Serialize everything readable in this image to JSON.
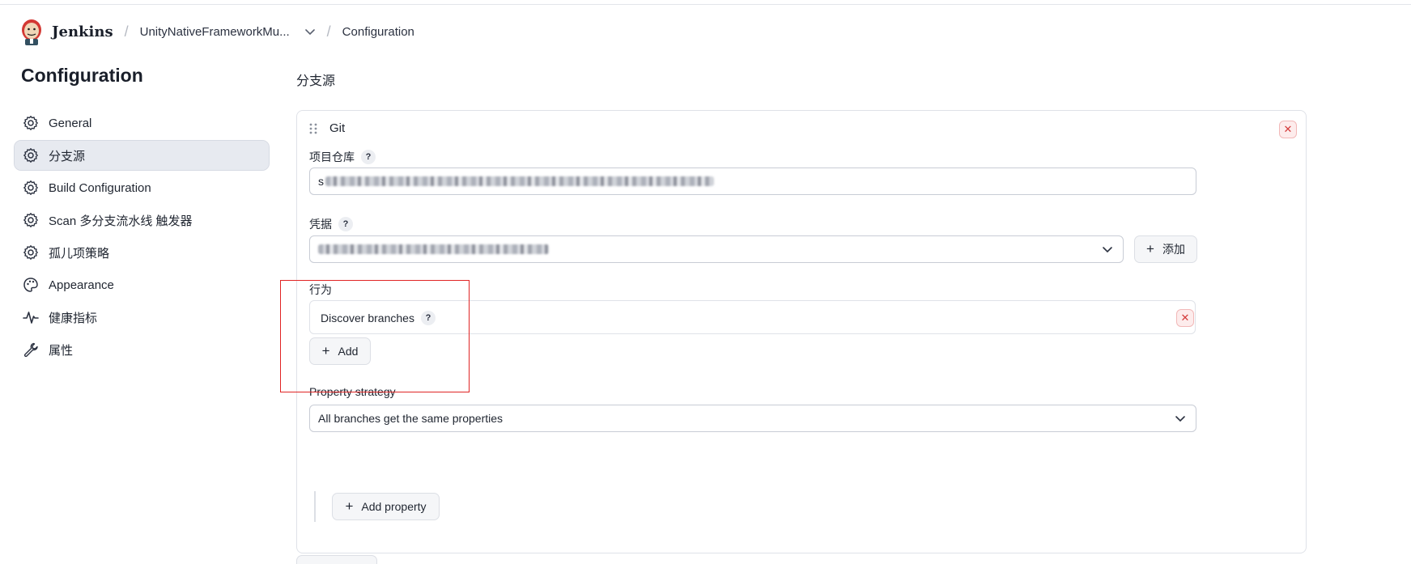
{
  "header": {
    "brand": "Jenkins",
    "separator": "/",
    "project": "UnityNativeFrameworkMu...",
    "page": "Configuration"
  },
  "sidebar": {
    "title": "Configuration",
    "items": [
      {
        "label": "General",
        "icon": "gear-icon",
        "active": false
      },
      {
        "label": "分支源",
        "icon": "gear-icon",
        "active": true
      },
      {
        "label": "Build Configuration",
        "icon": "gear-icon",
        "active": false
      },
      {
        "label": "Scan 多分支流水线 触发器",
        "icon": "gear-icon",
        "active": false
      },
      {
        "label": "孤儿项策略",
        "icon": "gear-icon",
        "active": false
      },
      {
        "label": "Appearance",
        "icon": "palette-icon",
        "active": false
      },
      {
        "label": "健康指标",
        "icon": "pulse-icon",
        "active": false
      },
      {
        "label": "属性",
        "icon": "wrench-icon",
        "active": false
      }
    ]
  },
  "main": {
    "section_title": "分支源",
    "git": {
      "title": "Git",
      "repo_label": "项目仓库",
      "repo_value_prefix": "s",
      "credentials_label": "凭据",
      "add_credentials_label": "添加",
      "behavior_label": "行为",
      "behavior_item": "Discover branches",
      "add_behavior_label": "Add",
      "property_strategy_label": "Property strategy",
      "property_strategy_value": "All branches get the same properties",
      "add_property_label": "Add property"
    },
    "help_glyph": "?",
    "remove_glyph": "✕",
    "plus_glyph": "+"
  },
  "colors": {
    "accent_border": "#c8ccd5",
    "remove_red": "#d43a3a",
    "highlight_box": "#e02424"
  }
}
